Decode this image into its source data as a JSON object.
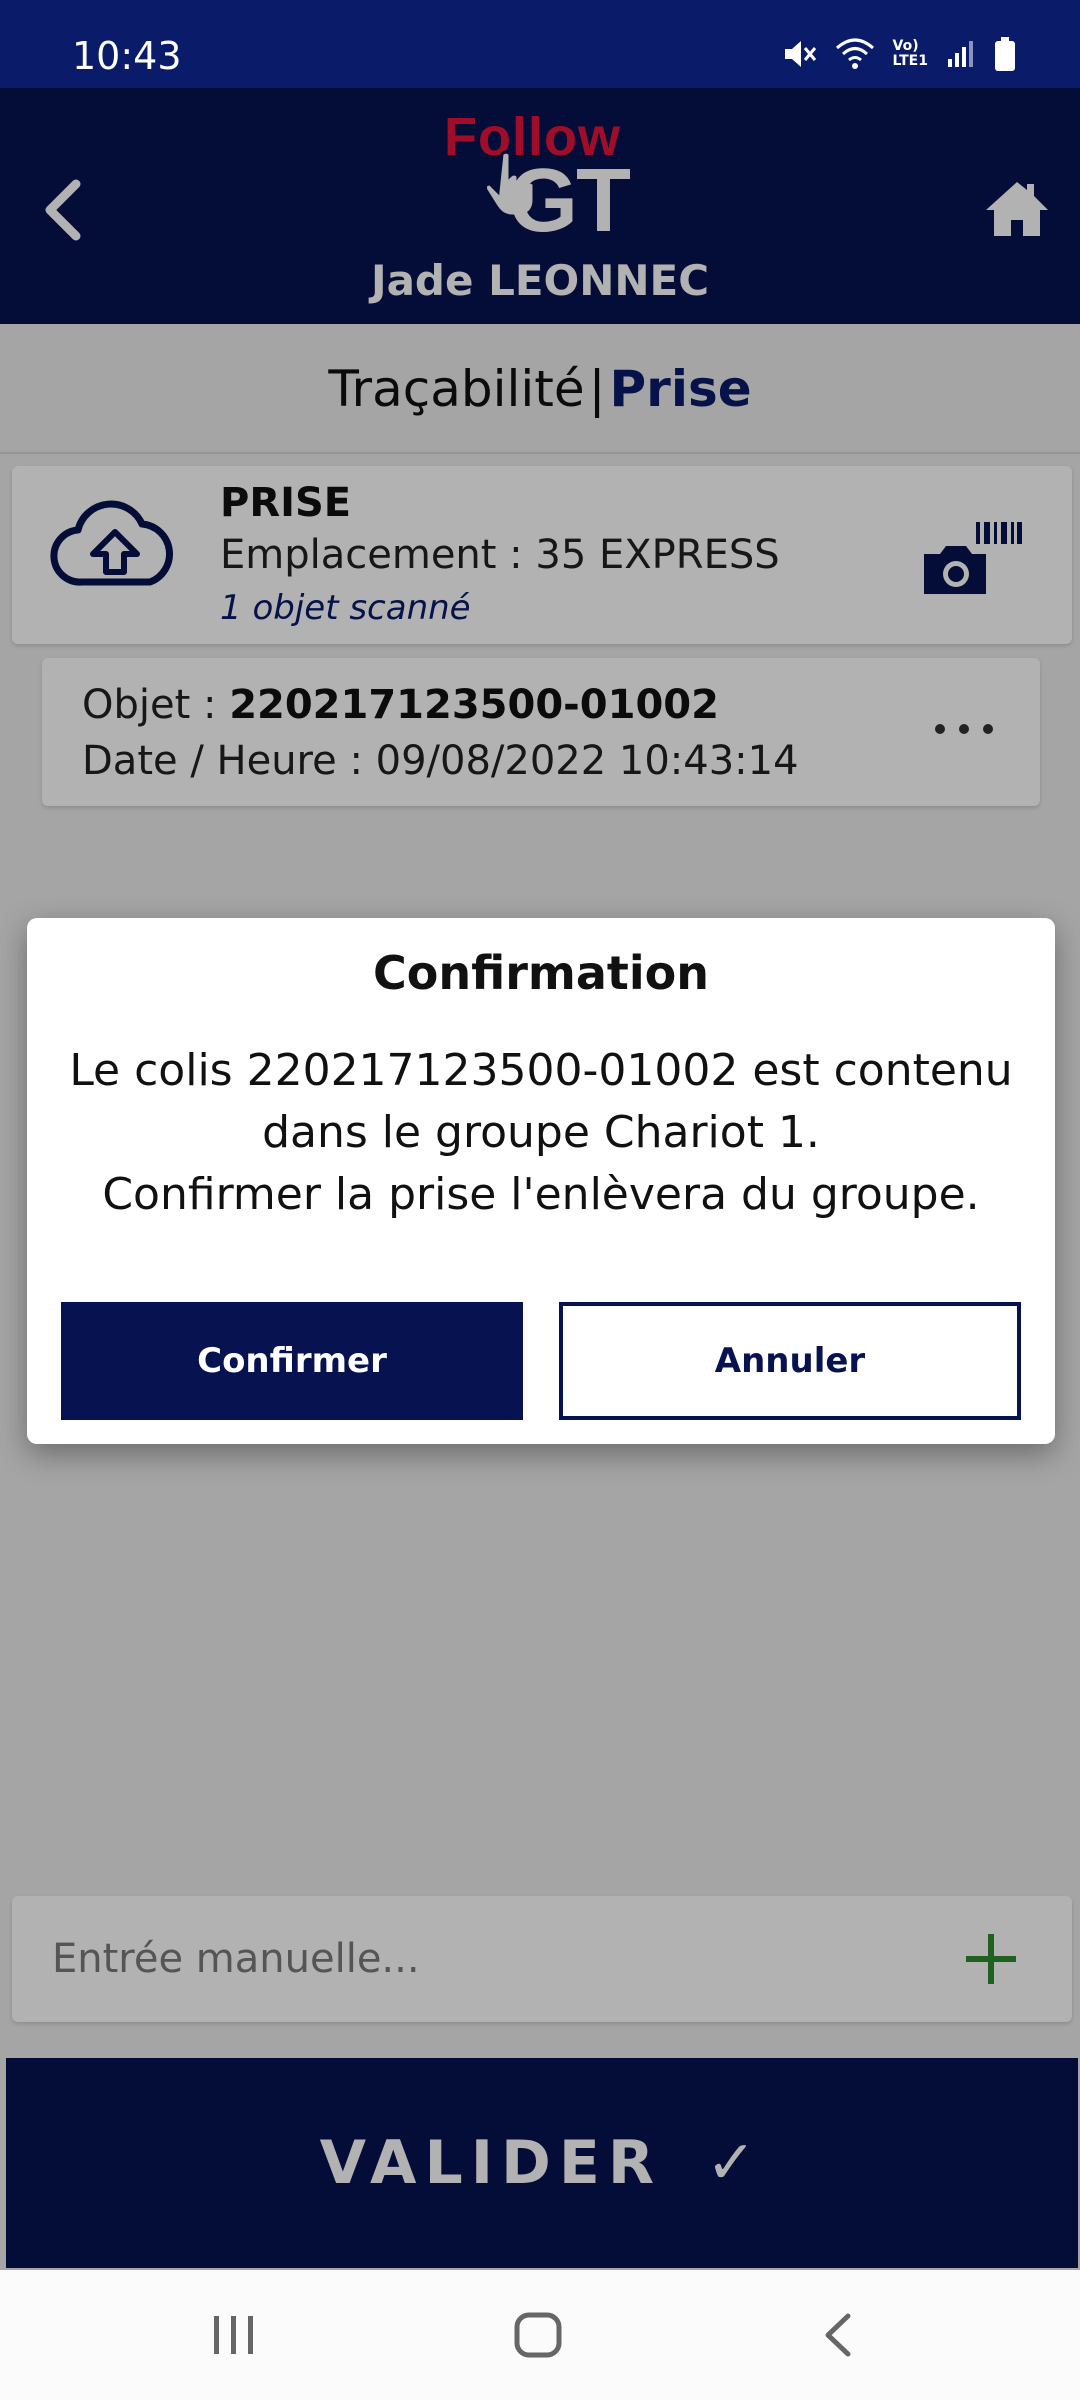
{
  "status_bar": {
    "time": "10:43",
    "icons": [
      "mute-icon",
      "wifi-icon",
      "volte-icon",
      "signal-icon",
      "battery-icon"
    ],
    "volte_label": "Vo)\nLTE1"
  },
  "header": {
    "logo_top": "Follow",
    "logo_bottom": "GT",
    "user_name": "Jade LEONNEC"
  },
  "tabs": {
    "first": "Traçabilité",
    "separator": "|",
    "active": "Prise"
  },
  "scan_card": {
    "title": "PRISE",
    "location": "Emplacement : 35 EXPRESS",
    "count": "1 objet scanné"
  },
  "object_item": {
    "object_label": "Objet : ",
    "object_id": "220217123500-01002",
    "datetime": "Date / Heure : 09/08/2022 10:43:14"
  },
  "manual_entry": {
    "placeholder": "Entrée manuelle...",
    "value": ""
  },
  "validate_button": {
    "label": "VALIDER",
    "check": "✓"
  },
  "dialog": {
    "title": "Confirmation",
    "message_line1": "Le colis 220217123500-01002 est contenu",
    "message_line2": "dans le groupe Chariot 1.",
    "message_line3": "Confirmer la prise l'enlèvera du groupe.",
    "confirm_label": "Confirmer",
    "cancel_label": "Annuler"
  },
  "colors": {
    "primary": "#061350",
    "status_bar": "#0a1b6a",
    "logo_red": "#e4143c",
    "plus_green": "#2e8b2e"
  }
}
